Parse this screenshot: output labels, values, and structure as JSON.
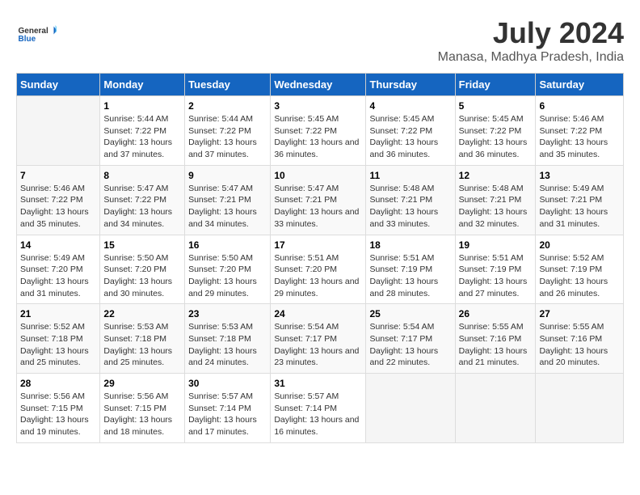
{
  "header": {
    "logo_general": "General",
    "logo_blue": "Blue",
    "title": "July 2024",
    "subtitle": "Manasa, Madhya Pradesh, India"
  },
  "days_of_week": [
    "Sunday",
    "Monday",
    "Tuesday",
    "Wednesday",
    "Thursday",
    "Friday",
    "Saturday"
  ],
  "weeks": [
    [
      {
        "day": "",
        "sunrise": "",
        "sunset": "",
        "daylight": ""
      },
      {
        "day": "1",
        "sunrise": "Sunrise: 5:44 AM",
        "sunset": "Sunset: 7:22 PM",
        "daylight": "Daylight: 13 hours and 37 minutes."
      },
      {
        "day": "2",
        "sunrise": "Sunrise: 5:44 AM",
        "sunset": "Sunset: 7:22 PM",
        "daylight": "Daylight: 13 hours and 37 minutes."
      },
      {
        "day": "3",
        "sunrise": "Sunrise: 5:45 AM",
        "sunset": "Sunset: 7:22 PM",
        "daylight": "Daylight: 13 hours and 36 minutes."
      },
      {
        "day": "4",
        "sunrise": "Sunrise: 5:45 AM",
        "sunset": "Sunset: 7:22 PM",
        "daylight": "Daylight: 13 hours and 36 minutes."
      },
      {
        "day": "5",
        "sunrise": "Sunrise: 5:45 AM",
        "sunset": "Sunset: 7:22 PM",
        "daylight": "Daylight: 13 hours and 36 minutes."
      },
      {
        "day": "6",
        "sunrise": "Sunrise: 5:46 AM",
        "sunset": "Sunset: 7:22 PM",
        "daylight": "Daylight: 13 hours and 35 minutes."
      }
    ],
    [
      {
        "day": "7",
        "sunrise": "Sunrise: 5:46 AM",
        "sunset": "Sunset: 7:22 PM",
        "daylight": "Daylight: 13 hours and 35 minutes."
      },
      {
        "day": "8",
        "sunrise": "Sunrise: 5:47 AM",
        "sunset": "Sunset: 7:22 PM",
        "daylight": "Daylight: 13 hours and 34 minutes."
      },
      {
        "day": "9",
        "sunrise": "Sunrise: 5:47 AM",
        "sunset": "Sunset: 7:21 PM",
        "daylight": "Daylight: 13 hours and 34 minutes."
      },
      {
        "day": "10",
        "sunrise": "Sunrise: 5:47 AM",
        "sunset": "Sunset: 7:21 PM",
        "daylight": "Daylight: 13 hours and 33 minutes."
      },
      {
        "day": "11",
        "sunrise": "Sunrise: 5:48 AM",
        "sunset": "Sunset: 7:21 PM",
        "daylight": "Daylight: 13 hours and 33 minutes."
      },
      {
        "day": "12",
        "sunrise": "Sunrise: 5:48 AM",
        "sunset": "Sunset: 7:21 PM",
        "daylight": "Daylight: 13 hours and 32 minutes."
      },
      {
        "day": "13",
        "sunrise": "Sunrise: 5:49 AM",
        "sunset": "Sunset: 7:21 PM",
        "daylight": "Daylight: 13 hours and 31 minutes."
      }
    ],
    [
      {
        "day": "14",
        "sunrise": "Sunrise: 5:49 AM",
        "sunset": "Sunset: 7:20 PM",
        "daylight": "Daylight: 13 hours and 31 minutes."
      },
      {
        "day": "15",
        "sunrise": "Sunrise: 5:50 AM",
        "sunset": "Sunset: 7:20 PM",
        "daylight": "Daylight: 13 hours and 30 minutes."
      },
      {
        "day": "16",
        "sunrise": "Sunrise: 5:50 AM",
        "sunset": "Sunset: 7:20 PM",
        "daylight": "Daylight: 13 hours and 29 minutes."
      },
      {
        "day": "17",
        "sunrise": "Sunrise: 5:51 AM",
        "sunset": "Sunset: 7:20 PM",
        "daylight": "Daylight: 13 hours and 29 minutes."
      },
      {
        "day": "18",
        "sunrise": "Sunrise: 5:51 AM",
        "sunset": "Sunset: 7:19 PM",
        "daylight": "Daylight: 13 hours and 28 minutes."
      },
      {
        "day": "19",
        "sunrise": "Sunrise: 5:51 AM",
        "sunset": "Sunset: 7:19 PM",
        "daylight": "Daylight: 13 hours and 27 minutes."
      },
      {
        "day": "20",
        "sunrise": "Sunrise: 5:52 AM",
        "sunset": "Sunset: 7:19 PM",
        "daylight": "Daylight: 13 hours and 26 minutes."
      }
    ],
    [
      {
        "day": "21",
        "sunrise": "Sunrise: 5:52 AM",
        "sunset": "Sunset: 7:18 PM",
        "daylight": "Daylight: 13 hours and 25 minutes."
      },
      {
        "day": "22",
        "sunrise": "Sunrise: 5:53 AM",
        "sunset": "Sunset: 7:18 PM",
        "daylight": "Daylight: 13 hours and 25 minutes."
      },
      {
        "day": "23",
        "sunrise": "Sunrise: 5:53 AM",
        "sunset": "Sunset: 7:18 PM",
        "daylight": "Daylight: 13 hours and 24 minutes."
      },
      {
        "day": "24",
        "sunrise": "Sunrise: 5:54 AM",
        "sunset": "Sunset: 7:17 PM",
        "daylight": "Daylight: 13 hours and 23 minutes."
      },
      {
        "day": "25",
        "sunrise": "Sunrise: 5:54 AM",
        "sunset": "Sunset: 7:17 PM",
        "daylight": "Daylight: 13 hours and 22 minutes."
      },
      {
        "day": "26",
        "sunrise": "Sunrise: 5:55 AM",
        "sunset": "Sunset: 7:16 PM",
        "daylight": "Daylight: 13 hours and 21 minutes."
      },
      {
        "day": "27",
        "sunrise": "Sunrise: 5:55 AM",
        "sunset": "Sunset: 7:16 PM",
        "daylight": "Daylight: 13 hours and 20 minutes."
      }
    ],
    [
      {
        "day": "28",
        "sunrise": "Sunrise: 5:56 AM",
        "sunset": "Sunset: 7:15 PM",
        "daylight": "Daylight: 13 hours and 19 minutes."
      },
      {
        "day": "29",
        "sunrise": "Sunrise: 5:56 AM",
        "sunset": "Sunset: 7:15 PM",
        "daylight": "Daylight: 13 hours and 18 minutes."
      },
      {
        "day": "30",
        "sunrise": "Sunrise: 5:57 AM",
        "sunset": "Sunset: 7:14 PM",
        "daylight": "Daylight: 13 hours and 17 minutes."
      },
      {
        "day": "31",
        "sunrise": "Sunrise: 5:57 AM",
        "sunset": "Sunset: 7:14 PM",
        "daylight": "Daylight: 13 hours and 16 minutes."
      },
      {
        "day": "",
        "sunrise": "",
        "sunset": "",
        "daylight": ""
      },
      {
        "day": "",
        "sunrise": "",
        "sunset": "",
        "daylight": ""
      },
      {
        "day": "",
        "sunrise": "",
        "sunset": "",
        "daylight": ""
      }
    ]
  ]
}
